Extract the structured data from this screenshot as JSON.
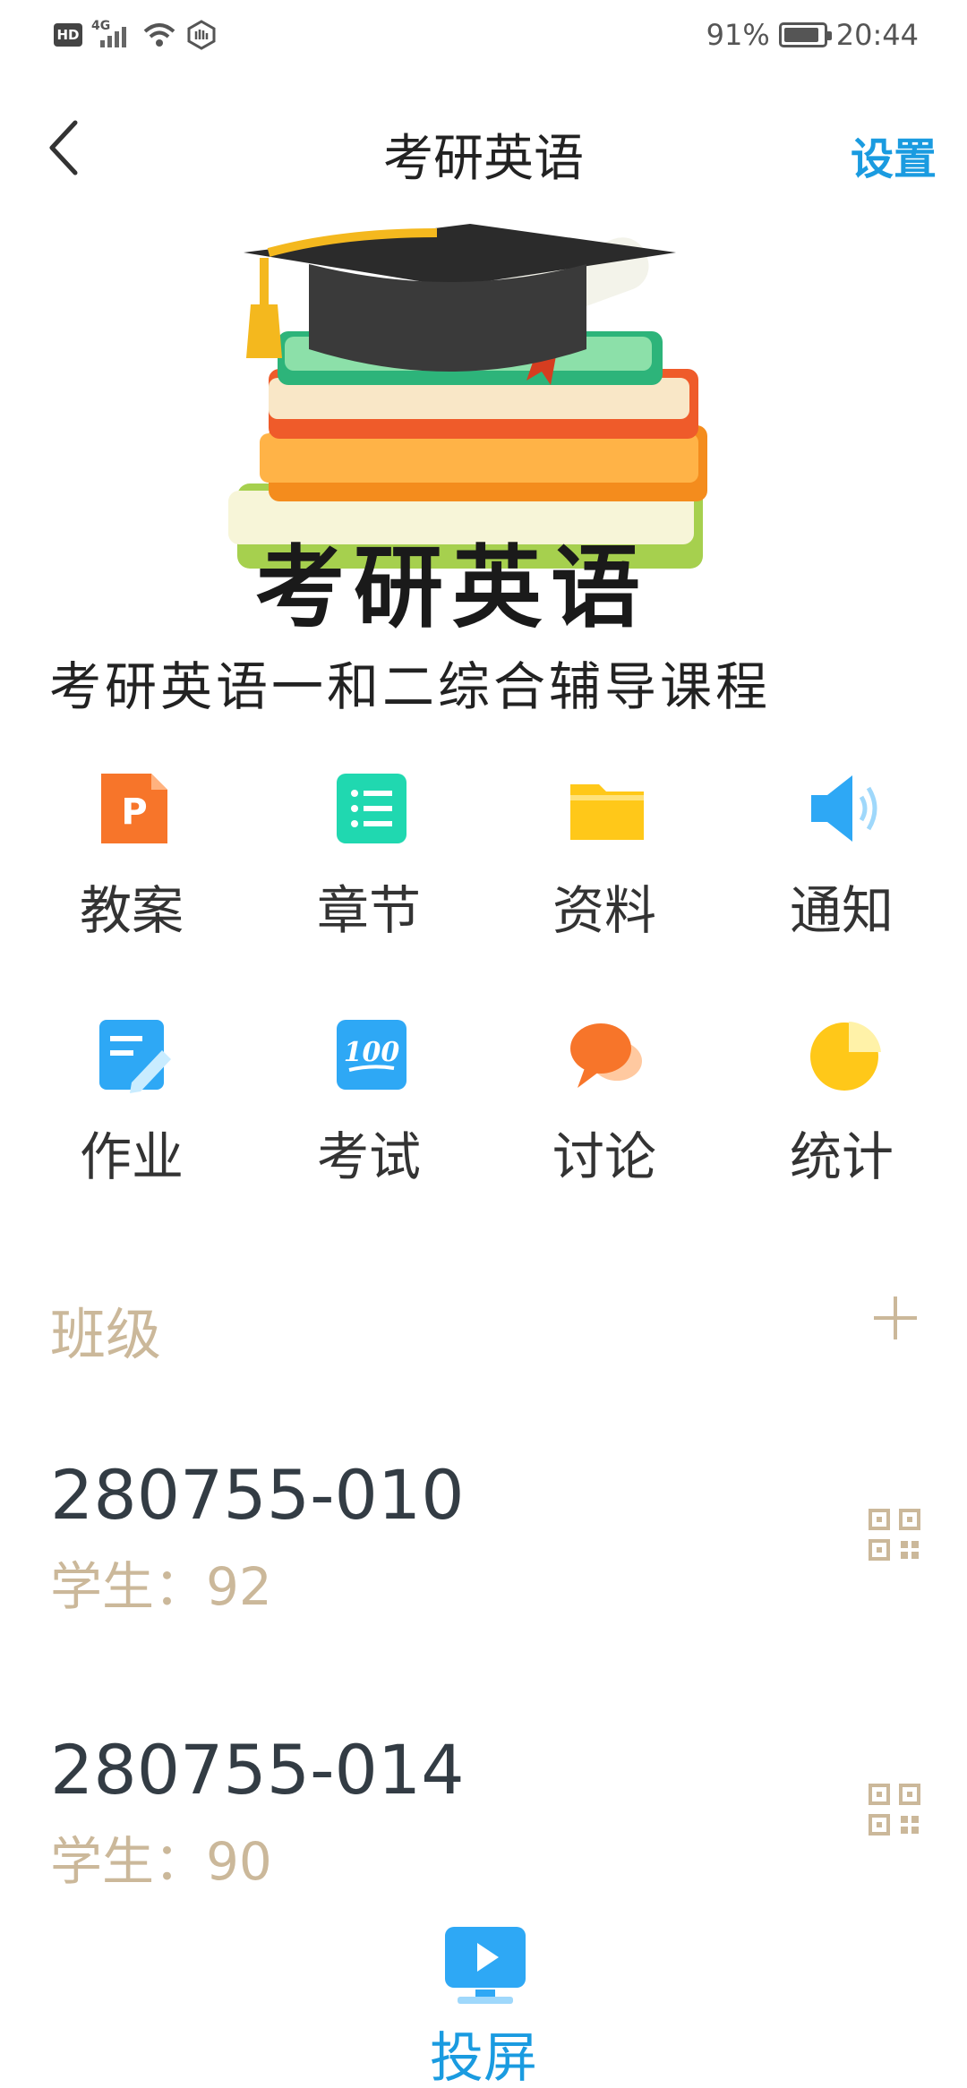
{
  "status_bar": {
    "hd": "HD",
    "network": "4G",
    "battery_pct": "91%",
    "time": "20:44"
  },
  "header": {
    "title": "考研英语",
    "settings_label": "设置"
  },
  "banner": {
    "title": "考研英语",
    "subtitle": "考研英语一和二综合辅导课程"
  },
  "grid": [
    {
      "label": "教案",
      "icon": "ppt-icon",
      "color": "#f7752a"
    },
    {
      "label": "章节",
      "icon": "list-icon",
      "color": "#20d8b0"
    },
    {
      "label": "资料",
      "icon": "folder-icon",
      "color": "#ffc819"
    },
    {
      "label": "通知",
      "icon": "speaker-icon",
      "color": "#2ea8f5"
    },
    {
      "label": "作业",
      "icon": "edit-icon",
      "color": "#2ea8f5"
    },
    {
      "label": "考试",
      "icon": "score-100-icon",
      "color": "#2ea8f5"
    },
    {
      "label": "讨论",
      "icon": "chat-icon",
      "color": "#f7752a"
    },
    {
      "label": "统计",
      "icon": "pie-chart-icon",
      "color": "#ffc819"
    }
  ],
  "classes": {
    "title": "班级",
    "items": [
      {
        "id": "280755-010",
        "students": "学生：92"
      },
      {
        "id": "280755-014",
        "students": "学生：90"
      }
    ]
  },
  "cast": {
    "label": "投屏"
  },
  "colors": {
    "accent": "#1a9be0",
    "muted": "#cbb89a"
  }
}
